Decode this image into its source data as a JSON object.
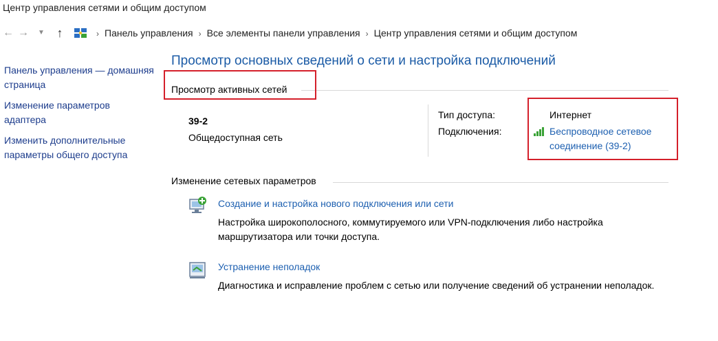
{
  "window": {
    "title": "Центр управления сетями и общим доступом"
  },
  "nav": {
    "back_icon": "←",
    "forward_icon": "→",
    "dropdown_icon": "⌄",
    "up_icon": "↑",
    "breadcrumbs": [
      "Панель управления",
      "Все элементы панели управления",
      "Центр управления сетями и общим доступом"
    ],
    "separator": "›"
  },
  "sidebar": {
    "items": [
      {
        "label": "Панель управления — домашняя страница"
      },
      {
        "label": "Изменение параметров адаптера"
      },
      {
        "label": "Изменить дополнительные параметры общего доступа"
      }
    ]
  },
  "main": {
    "title": "Просмотр основных сведений о сети и настройка подключений",
    "active_networks": {
      "heading": "Просмотр активных сетей",
      "network_name": "39-2",
      "network_type": "Общедоступная сеть",
      "access_type_label": "Тип доступа:",
      "access_type_value": "Интернет",
      "connections_label": "Подключения:",
      "connection_link": "Беспроводное сетевое соединение (39-2)"
    },
    "change_settings": {
      "heading": "Изменение сетевых параметров",
      "tasks": [
        {
          "icon": "new-connection-icon",
          "link": "Создание и настройка нового подключения или сети",
          "description": "Настройка широкополосного, коммутируемого или VPN-подключения либо настройка маршрутизатора или точки доступа."
        },
        {
          "icon": "troubleshoot-icon",
          "link": "Устранение неполадок",
          "description": "Диагностика и исправление проблем с сетью или получение сведений об устранении неполадок."
        }
      ]
    }
  },
  "colors": {
    "title_blue": "#1b5ba6",
    "link_blue": "#1c5fb0",
    "highlight_red": "#d41f2a",
    "signal_green": "#3aa236"
  }
}
